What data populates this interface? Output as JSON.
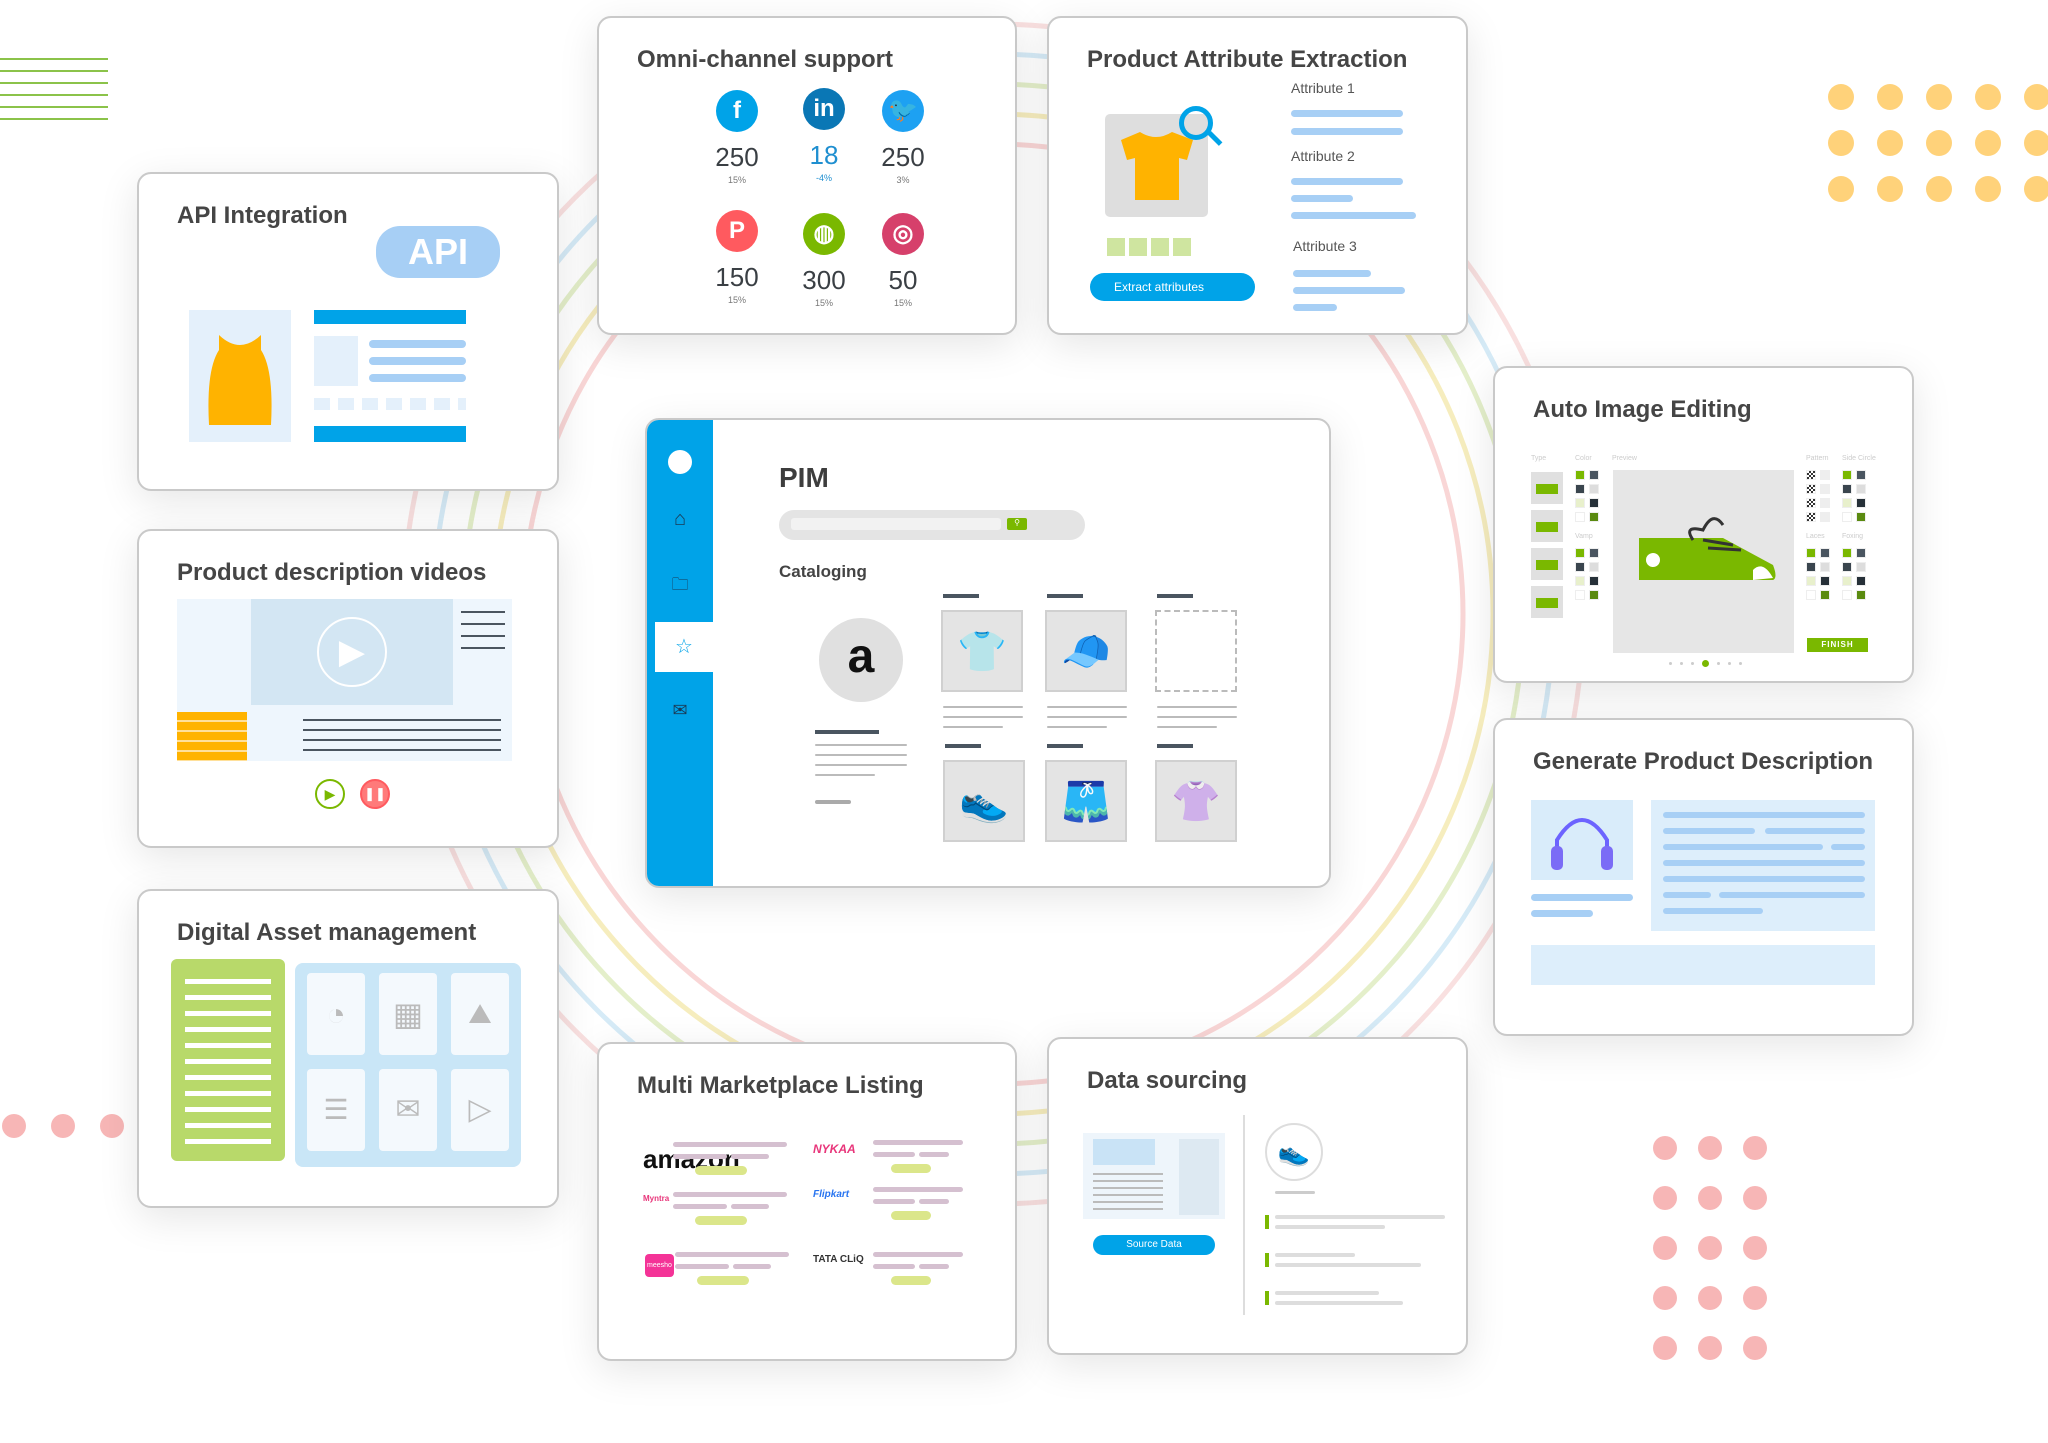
{
  "colors": {
    "accent_blue": "#00a3e8",
    "green": "#7ab800",
    "yellow": "#ffd27a",
    "pink": "#f7b6b6"
  },
  "api": {
    "title": "API Integration",
    "badge": "API"
  },
  "videos": {
    "title": "Product description videos"
  },
  "dam": {
    "title": "Digital Asset management"
  },
  "omni": {
    "title": "Omni-channel support",
    "channels": [
      {
        "icon": "facebook-icon",
        "glyph": "f",
        "color": "#00a3e8",
        "count": "250",
        "change": "15%"
      },
      {
        "icon": "linkedin-icon",
        "glyph": "in",
        "color": "#0a77b5",
        "count": "18",
        "change": "-4%"
      },
      {
        "icon": "twitter-icon",
        "glyph": "🐦",
        "color": "#1da1f2",
        "count": "250",
        "change": "3%"
      },
      {
        "icon": "pinterest-icon",
        "glyph": "P",
        "color": "#ff5a5f",
        "count": "150",
        "change": "15%"
      },
      {
        "icon": "dribbble-icon",
        "glyph": "◍",
        "color": "#7ab800",
        "count": "300",
        "change": "15%"
      },
      {
        "icon": "instagram-icon",
        "glyph": "◎",
        "color": "#d6406b",
        "count": "50",
        "change": "15%"
      }
    ]
  },
  "attributes": {
    "title": "Product Attribute Extraction",
    "labels": [
      "Attribute 1",
      "Attribute 2",
      "Attribute 3"
    ],
    "button": "Extract attributes"
  },
  "pim": {
    "title": "PIM",
    "section": "Cataloging",
    "nav": [
      "home-icon",
      "folder-icon",
      "star-icon",
      "mail-icon"
    ],
    "active_nav": "star-icon"
  },
  "image_editing": {
    "title": "Auto Image Editing",
    "labels": {
      "type": "Type",
      "color": "Color",
      "preview": "Preview",
      "pattern": "Pattern",
      "side_circle": "Side Circle",
      "vamp": "Vamp",
      "laces": "Laces",
      "foxing": "Foxing"
    },
    "button": "FINISH",
    "current_slide": 4,
    "total_slides": 7
  },
  "gen_desc": {
    "title": "Generate Product Description"
  },
  "marketplace": {
    "title": "Multi Marketplace Listing",
    "logos": [
      "amazon",
      "NYKAA",
      "Myntra",
      "Flipkart",
      "meesho",
      "TATA CLiQ"
    ]
  },
  "sourcing": {
    "title": "Data sourcing",
    "button": "Source Data"
  }
}
